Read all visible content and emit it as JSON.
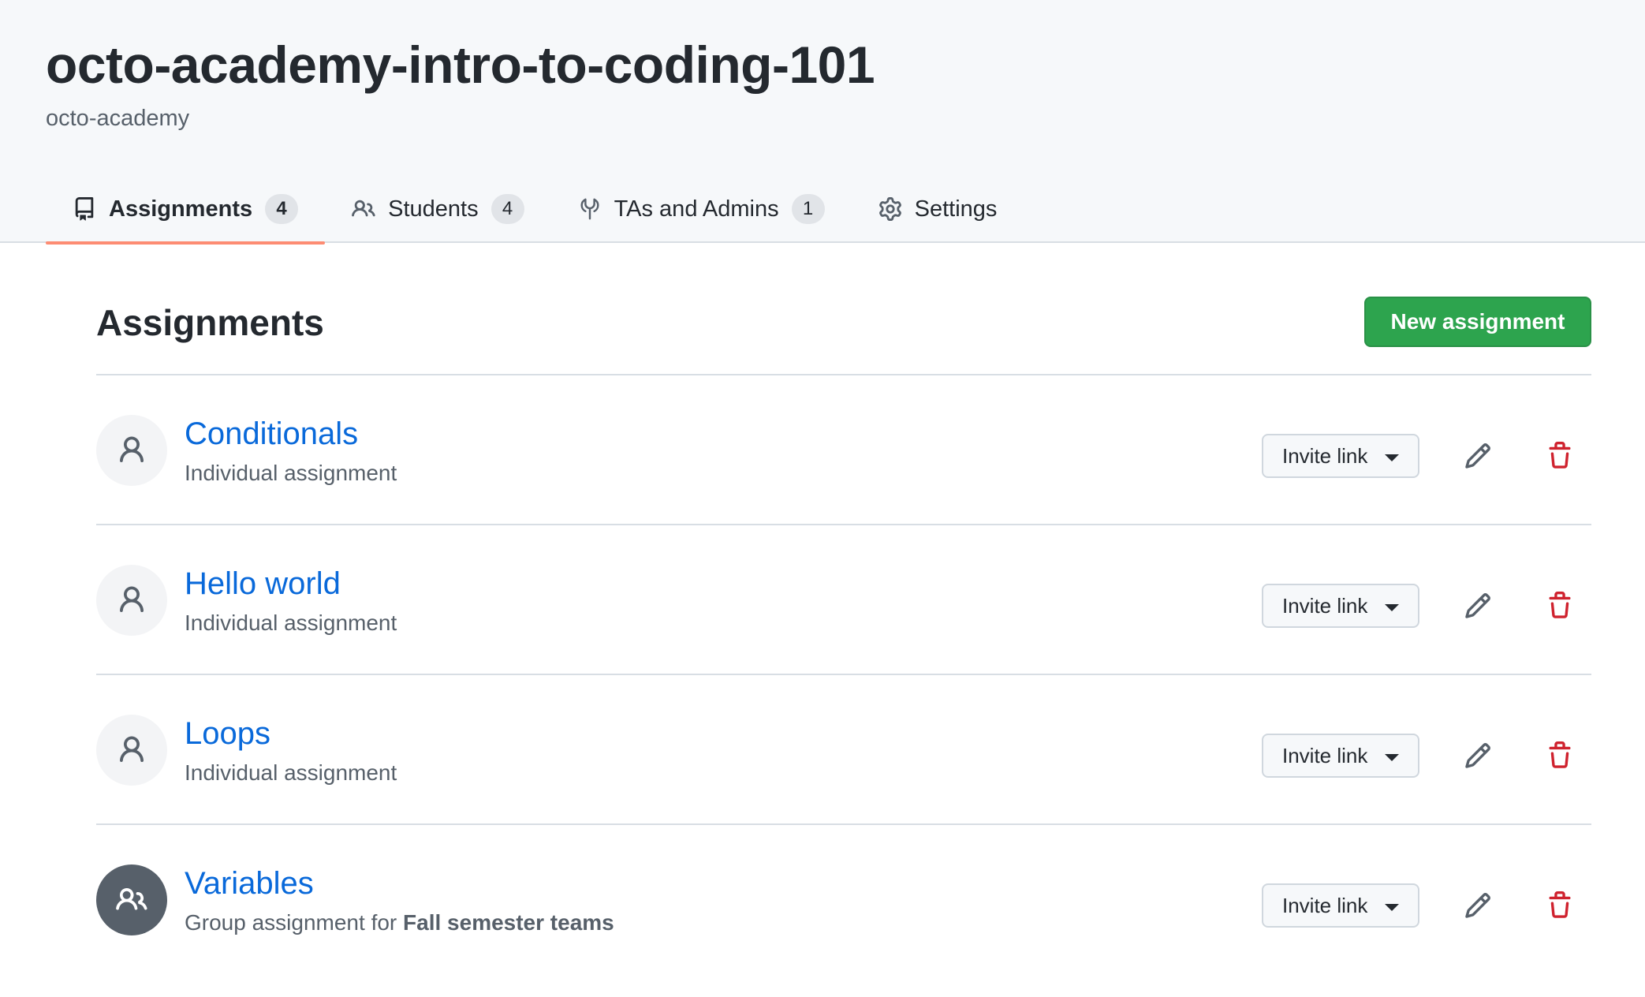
{
  "classroom": {
    "title": "octo-academy-intro-to-coding-101",
    "organization": "octo-academy"
  },
  "tabs": [
    {
      "label": "Assignments",
      "count": "4",
      "icon": "repo-icon",
      "active": true
    },
    {
      "label": "Students",
      "count": "4",
      "icon": "people-icon",
      "active": false
    },
    {
      "label": "TAs and Admins",
      "count": "1",
      "icon": "tools-icon",
      "active": false
    },
    {
      "label": "Settings",
      "count": "",
      "icon": "gear-icon",
      "active": false
    }
  ],
  "assignments_section": {
    "title": "Assignments",
    "new_button": "New assignment"
  },
  "assignments": [
    {
      "title": "Conditionals",
      "type_text": "Individual assignment",
      "group_name": "",
      "icon": "person-icon",
      "invite_label": "Invite link"
    },
    {
      "title": "Hello world",
      "type_text": "Individual assignment",
      "group_name": "",
      "icon": "person-icon",
      "invite_label": "Invite link"
    },
    {
      "title": "Loops",
      "type_text": "Individual assignment",
      "group_name": "",
      "icon": "person-icon",
      "invite_label": "Invite link"
    },
    {
      "title": "Variables",
      "type_text": "Group assignment for ",
      "group_name": "Fall semester teams",
      "icon": "people-icon",
      "invite_label": "Invite link"
    }
  ],
  "colors": {
    "accent_link": "#0969da",
    "primary_button": "#2da44e",
    "danger": "#cf222e",
    "tab_underline": "#fd8c73"
  }
}
